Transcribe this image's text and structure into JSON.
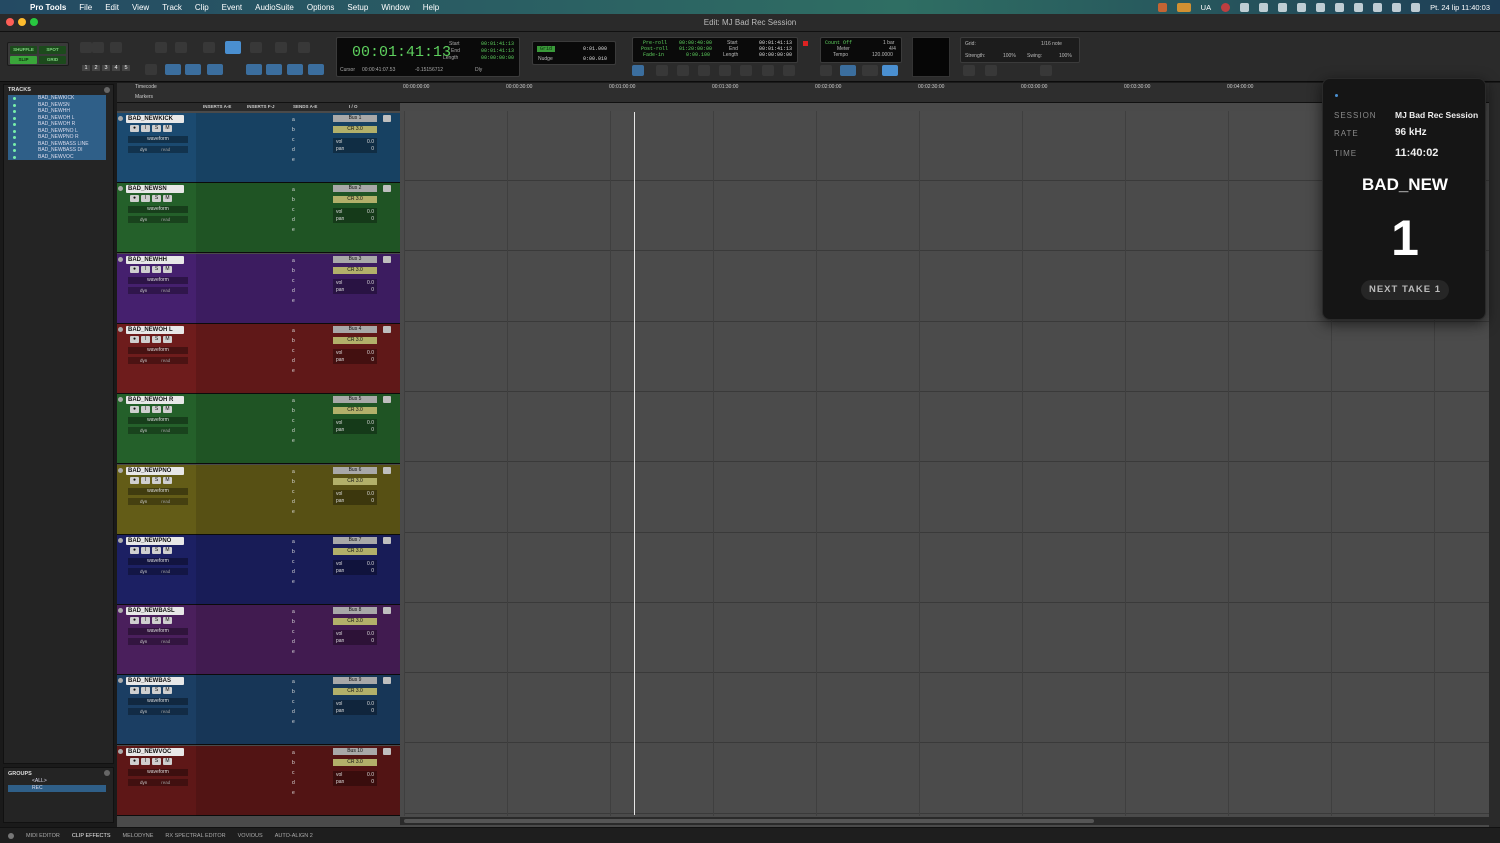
{
  "menubar": {
    "app_name": "Pro Tools",
    "items": [
      "File",
      "Edit",
      "View",
      "Track",
      "Clip",
      "Event",
      "AudioSuite",
      "Options",
      "Setup",
      "Window",
      "Help"
    ],
    "input_source": "UA",
    "clock": "Pt. 24 lip  11:40:03"
  },
  "window": {
    "title": "Edit: MJ Bad Rec Session"
  },
  "toolbar": {
    "modes": [
      "SHUFFLE",
      "SPOT",
      "SLIP",
      "GRID"
    ],
    "zoom_presets": [
      "1",
      "2",
      "3",
      "4",
      "5"
    ],
    "main_counter": "00:01:41:13",
    "cursor_label": "Cursor",
    "cursor_value": "00:00:41:07.53",
    "cursor_extra": "-0.15156712",
    "dly_label": "Dly",
    "selection": {
      "start_label": "Start",
      "end_label": "End",
      "length_label": "Length",
      "start": "00:01:41:13",
      "end": "00:01:41:13",
      "length": "00:00:00:00"
    },
    "grid_label": "Grid",
    "grid_value": "0:01.000",
    "nudge_label": "Nudge",
    "nudge_value": "0:00.010",
    "preroll_label": "Pre-roll",
    "preroll": "00:00:40:00",
    "postroll_label": "Post-roll",
    "postroll": "01:20:00:00",
    "fadein_label": "Fade-in",
    "fadein": "0:00.100",
    "transport_start": "00:01:41:13",
    "transport_end": "00:01:41:13",
    "transport_length": "00:00:00:00",
    "countoff_label": "Count Off",
    "countoff": "1 bar",
    "meter_label": "Meter",
    "meter": "4/4",
    "tempo_label": "Tempo",
    "tempo": "120.0000",
    "grid2_label": "Grid:",
    "grid2_value": "1/16 note",
    "strength_label": "Strength:",
    "strength": "100%",
    "swing_label": "Swing:",
    "swing": "100%"
  },
  "tracks_panel": {
    "title": "TRACKS",
    "items": [
      "BAD_NEWKICK",
      "BAD_NEWSN",
      "BAD_NEWHH",
      "BAD_NEWOH L",
      "BAD_NEWOH R",
      "BAD_NEWPNO L",
      "BAD_NEWPNO R",
      "BAD_NEWBASS LINE",
      "BAD_NEWBASS DI",
      "BAD_NEWVOC"
    ]
  },
  "groups_panel": {
    "title": "GROUPS",
    "items": [
      "<ALL>",
      "REC"
    ]
  },
  "rulers": {
    "timecode_label": "Timecode",
    "markers_label": "Markers",
    "ticks": [
      "00:00:00:00",
      "00:00:30:00",
      "00:01:00:00",
      "00:01:30:00",
      "00:02:00:00",
      "00:02:30:00",
      "00:03:00:00",
      "00:03:30:00",
      "00:04:00:00"
    ]
  },
  "columns": {
    "inserts_ae": "INSERTS A-E",
    "inserts_fj": "INSERTS F-J",
    "sends_ae": "SENDS A-E",
    "io": "I / O"
  },
  "track_common": {
    "waveform": "waveform",
    "dyn": "dyn",
    "read": "read",
    "vol_label": "vol",
    "vol": "0.0",
    "pan_label": "pan",
    "pan": "0",
    "input": "CR 3.0",
    "buttons": [
      "I",
      "S",
      "M"
    ],
    "send_letters": [
      "a",
      "b",
      "c",
      "d",
      "e"
    ]
  },
  "edit_tracks": [
    {
      "name": "BAD_NEWKICK",
      "bus": "Bus 1",
      "color": "#1b4a70"
    },
    {
      "name": "BAD_NEWSN",
      "bus": "Bus 2",
      "color": "#24602a"
    },
    {
      "name": "BAD_NEWHH",
      "bus": "Bus 3",
      "color": "#45206e"
    },
    {
      "name": "BAD_NEWOH L",
      "bus": "Bus 4",
      "color": "#6e1c1c"
    },
    {
      "name": "BAD_NEWOH R",
      "bus": "Bus 5",
      "color": "#24602a"
    },
    {
      "name": "BAD_NEWPNO",
      "bus": "Bus 6",
      "color": "#635c17"
    },
    {
      "name": "BAD_NEWPNO",
      "bus": "Bus 7",
      "color": "#1c2063"
    },
    {
      "name": "BAD_NEWBASL",
      "bus": "Bus 8",
      "color": "#4a1f5c"
    },
    {
      "name": "BAD_NEWBAS",
      "bus": "Bus 9",
      "color": "#1b3e63"
    },
    {
      "name": "BAD_NEWVOC",
      "bus": "Bus 10",
      "color": "#5e1717"
    }
  ],
  "bottom_tabs": [
    "MIDI EDITOR",
    "CLIP EFFECTS",
    "MELODYNE",
    "RX SPECTRAL EDITOR",
    "VOVIOUS",
    "AUTO-ALIGN 2"
  ],
  "overlay": {
    "session_label": "SESSION",
    "session": "MJ Bad Rec Session",
    "rate_label": "RATE",
    "rate": "96 kHz",
    "time_label": "TIME",
    "time": "11:40:02",
    "track": "BAD_NEW",
    "take": "1",
    "next_take": "NEXT TAKE 1"
  }
}
